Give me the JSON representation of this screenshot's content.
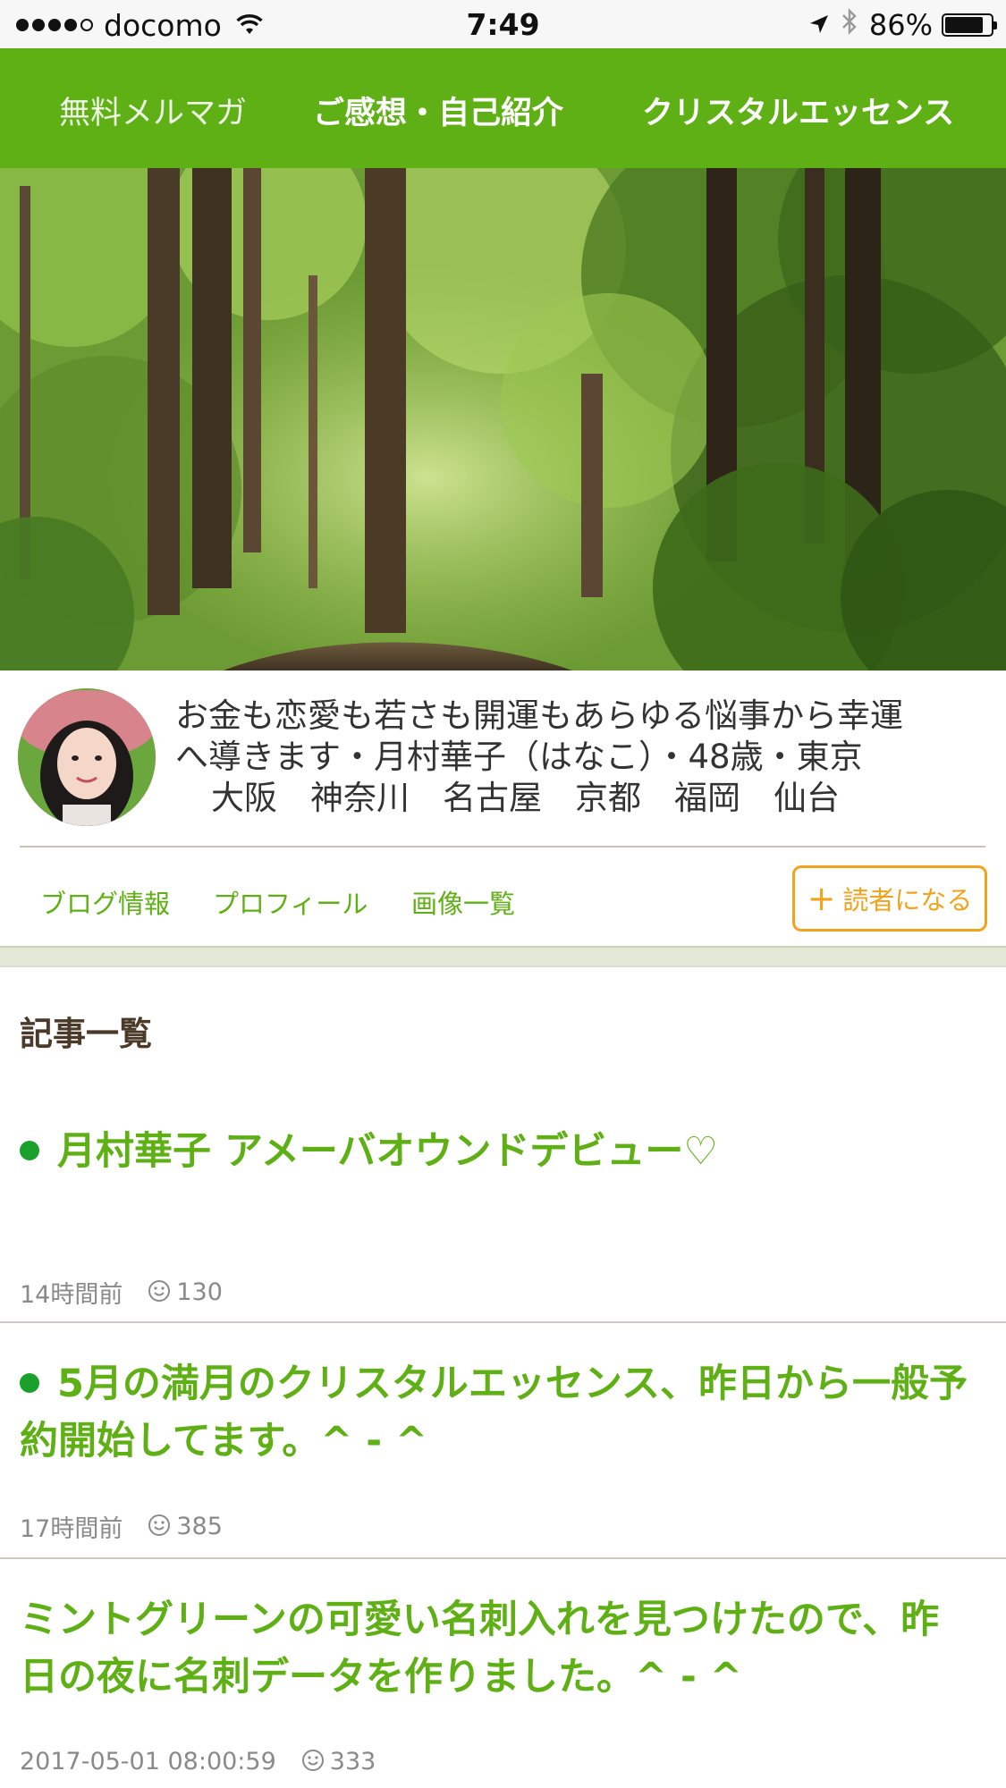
{
  "status_bar": {
    "carrier": "docomo",
    "time": "7:49",
    "battery_percent": "86%",
    "battery_level": 0.86
  },
  "nav": {
    "items": [
      {
        "label": "無料メルマガ"
      },
      {
        "label": "ご感想・自己紹介"
      },
      {
        "label": "クリスタルエッセンス"
      }
    ]
  },
  "profile": {
    "description_line1": "お金も恋愛も若さも開運もあらゆる悩事から幸運",
    "description_line2": "へ導きます・月村華子（はなこ）・48歳・東京",
    "description_line3": "大阪　神奈川　名古屋　京都　福岡　仙台"
  },
  "subnav": {
    "items": [
      {
        "label": "ブログ情報"
      },
      {
        "label": "プロフィール"
      },
      {
        "label": "画像一覧"
      }
    ],
    "follow_label": "読者になる"
  },
  "articles_section": {
    "title": "記事一覧",
    "items": [
      {
        "title": "月村華子 アメーバオウンドデビュー♡",
        "time": "14時間前",
        "likes": "130",
        "bullet": true
      },
      {
        "title": "5月の満月のクリスタルエッセンス、昨日から一般予約開始してます。^ - ^",
        "time": "17時間前",
        "likes": "385",
        "bullet": true
      },
      {
        "title": "ミントグリーンの可愛い名刺入れを見つけたので、昨日の夜に名刺データを作りました。^ - ^",
        "time": "2017-05-01 08:00:59",
        "likes": "333",
        "bullet": false
      }
    ]
  },
  "colors": {
    "brand_green": "#5eb014",
    "bullet_green": "#1aa12c",
    "follow_orange": "#f3a31b"
  }
}
